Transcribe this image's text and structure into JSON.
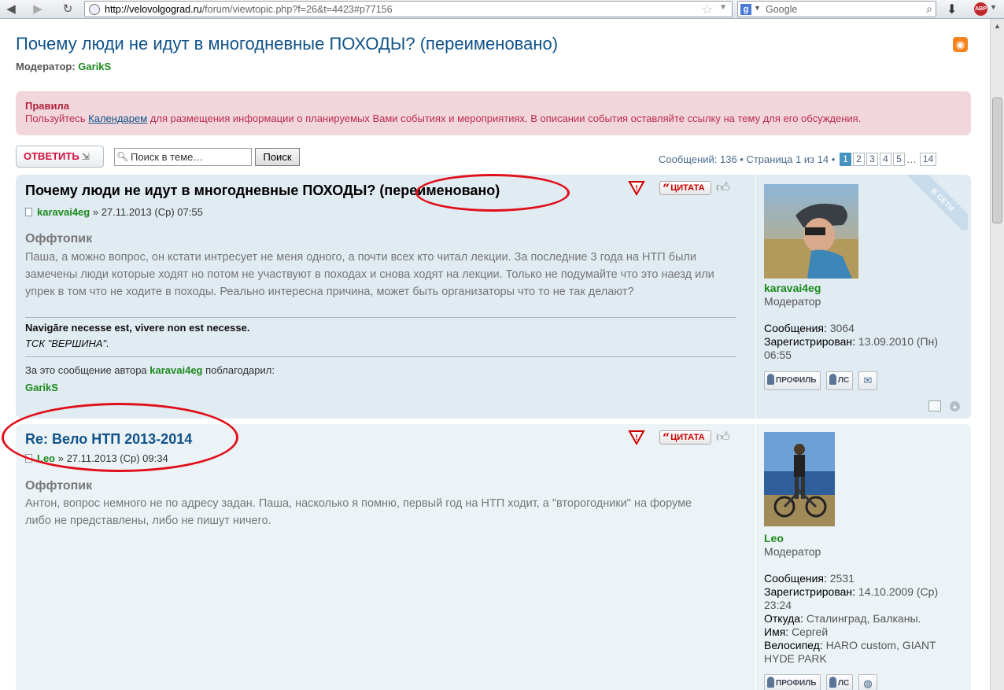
{
  "browser": {
    "url_host": "http://velovolgograd.ru",
    "url_path": "/forum/viewtopic.php?f=26&t=4423#p77156",
    "search_engine": "Google",
    "abp_label": "ABP"
  },
  "topic": {
    "title": "Почему люди не идут в многодневные ПОХОДЫ? (переименовано)",
    "moderator_label": "Модератор:",
    "moderator_name": "GarikS"
  },
  "rules": {
    "heading": "Правила",
    "text_before": "Пользуйтесь ",
    "link": "Календарем",
    "text_after": " для размещения информации о планируемых Вами событиях и мероприятиях. В описании события оставляйте ссылку на тему для его обсуждения."
  },
  "toolbar": {
    "reply_label": "ОТВЕТИТЬ",
    "search_placeholder": "Поиск в теме…",
    "search_button": "Поиск"
  },
  "pagination": {
    "summary": "Сообщений: 136 • Страница 1 из 14 •",
    "pages": [
      "1",
      "2",
      "3",
      "4",
      "5"
    ],
    "ellipsis": "…",
    "last": "14",
    "current": "1"
  },
  "posts": [
    {
      "title_main": "Почему люди не идут в многодневные ПОХОДЫ?",
      "title_suffix": "(переименовано)",
      "author": "karavai4eg",
      "date": " » 27.11.2013 (Ср) 07:55",
      "topic_label": "Оффтопик",
      "body": "Паша, а можно вопрос, он кстати интресует не меня одного, а почти всех кто читал лекции. За последние 3 года на НТП были замечены люди которые ходят но потом не участвуют в походах и снова ходят на лекции. Только не подумайте что это наезд или упрек в том что не ходите в походы. Реально интересна причина, может быть организаторы что то не так делают?",
      "signature_line1": "Navigāre necesse est, vivere non est necesse.",
      "signature_line2": "ТСК \"ВЕРШИНА\".",
      "thanks_before": "За это сообщение автора ",
      "thanks_author": "karavai4eg",
      "thanks_after": " поблагодарил:",
      "thanked_by": "GarikS",
      "quote_label": "ЦИТАТА",
      "online_badge": "В СЕТИ",
      "profile": {
        "name": "karavai4eg",
        "rank": "Модератор",
        "posts_label": "Сообщения:",
        "posts_value": "3064",
        "registered_label": "Зарегистрирован:",
        "registered_value": "13.09.2010 (Пн) 06:55",
        "btn_profile": "ПРОФИЛЬ",
        "btn_pm": "ЛС"
      }
    },
    {
      "title": "Re: Вело НТП 2013-2014",
      "author": "Leo",
      "date": " » 27.11.2013 (Ср) 09:34",
      "topic_label": "Оффтопик",
      "body": "Антон, вопрос немного не по адресу задан. Паша, насколько я помню, первый год на НТП ходит, а \"второгодники\" на форуме либо не представлены, либо не пишут ничего.",
      "quote_label": "ЦИТАТА",
      "profile": {
        "name": "Leo",
        "rank": "Модератор",
        "posts_label": "Сообщения:",
        "posts_value": "2531",
        "registered_label": "Зарегистрирован:",
        "registered_value": "14.10.2009 (Ср) 23:24",
        "from_label": "Откуда:",
        "from_value": "Сталинград, Балканы.",
        "name_label": "Имя:",
        "name_value": "Сергей",
        "bike_label": "Велосипед:",
        "bike_value": "HARO custom, GIANT HYDE PARK",
        "btn_profile": "ПРОФИЛЬ",
        "btn_pm": "ЛС"
      }
    }
  ],
  "colors": {
    "link_blue": "#105289",
    "username_green": "#1c8a1c",
    "reply_red": "#d31141",
    "annotation_red": "#e0101a"
  }
}
